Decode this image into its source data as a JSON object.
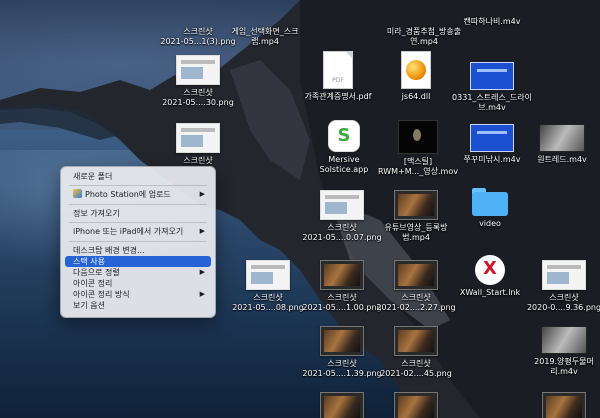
{
  "desktop_icons": [
    {
      "label": "스크린샷\n2021-05...1(3).png",
      "kind": "shot"
    },
    {
      "label": "게임_선택화면_스크\n랩.mp4",
      "kind": "dark"
    },
    {
      "label": "미라_경품추첨_방송출\n연.mp4",
      "kind": "dark"
    },
    {
      "label": "캔따하나비.m4v",
      "kind": "dark"
    },
    {
      "label": "스크린샷\n2021-05....30.png",
      "kind": "shot"
    },
    {
      "label": "가족관계증명서.pdf",
      "kind": "pdf"
    },
    {
      "label": "js64.dll",
      "kind": "dll"
    },
    {
      "label": "0331_스트레스_드라이\n브.m4v",
      "kind": "blue"
    },
    {
      "label": "스크린샷",
      "kind": "shot"
    },
    {
      "label": "Mersive\nSolstice.app",
      "kind": "app"
    },
    {
      "label": "[맥스틸]\nRWM+M..._영상.mov",
      "kind": "black"
    },
    {
      "label": "쭈꾸미낚시.m4v",
      "kind": "blue"
    },
    {
      "label": "원트레드.m4v",
      "kind": "video"
    },
    {
      "label": "스크린샷\n2021-05....0.07.png",
      "kind": "shot"
    },
    {
      "label": "유튜브영상_등록방\n법.mp4",
      "kind": "dark"
    },
    {
      "label": "video",
      "kind": "folder"
    },
    {
      "label": "스크린샷\n2021-05....08.png",
      "kind": "shot"
    },
    {
      "label": "스크린샷\n2021-05....1.00.png",
      "kind": "dark"
    },
    {
      "label": "스크린샷\n2021-02....2.27.png",
      "kind": "dark"
    },
    {
      "label": "XWall_Start.lnk",
      "kind": "lnk"
    },
    {
      "label": "스크린샷\n2020-0....9.36.png",
      "kind": "shot"
    },
    {
      "label": "스크린샷\n2021-05....1.39.png",
      "kind": "dark"
    },
    {
      "label": "스크린샷\n2021-02....45.png",
      "kind": "dark"
    },
    {
      "label": "2019.양평두물머\n리.m4v",
      "kind": "video"
    }
  ],
  "menu": {
    "new_folder": "새로운 폴더",
    "photo_station": "Photo Station에 업로드",
    "get_info": "정보 가져오기",
    "import_iphone": "iPhone 또는 iPad에서 가져오기",
    "change_bg": "데스크탑 배경 변경...",
    "use_stacks": "스택 사용",
    "sort_by": "다음으로 정렬",
    "clean_up": "아이콘 정리",
    "clean_up_by": "아이콘 정리 방식",
    "view_options": "보기 옵션",
    "arrow": "▶"
  }
}
